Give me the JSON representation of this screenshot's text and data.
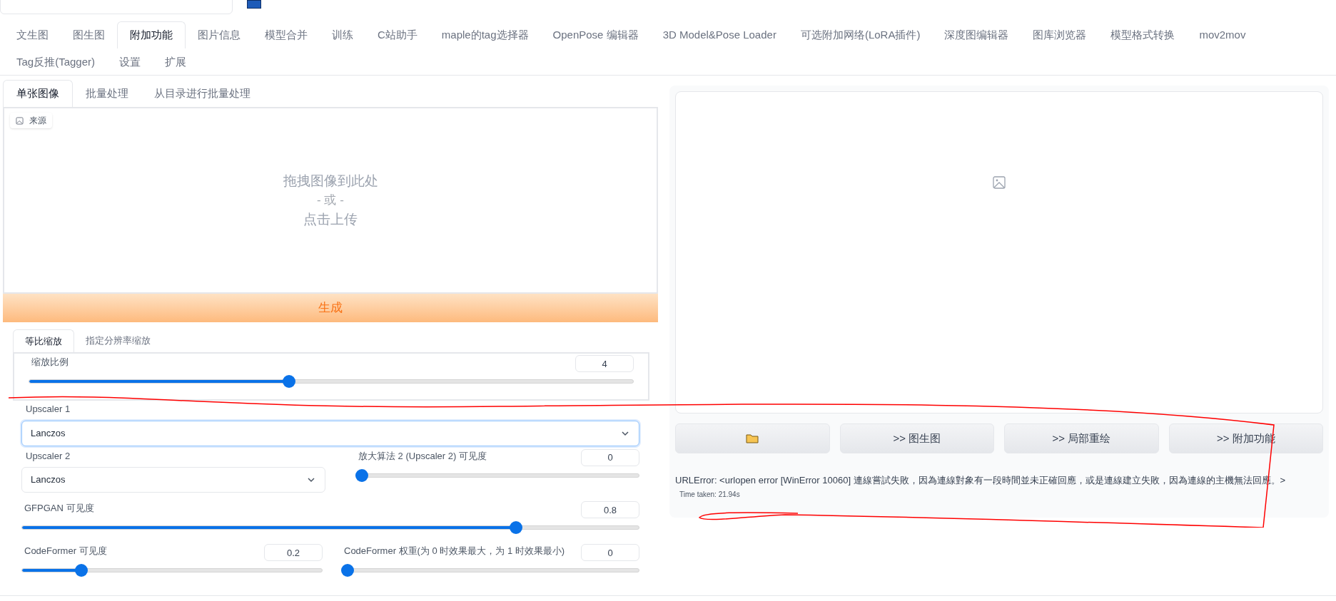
{
  "main_tabs": [
    {
      "label": "文生图",
      "selected": false
    },
    {
      "label": "图生图",
      "selected": false
    },
    {
      "label": "附加功能",
      "selected": true
    },
    {
      "label": "图片信息",
      "selected": false
    },
    {
      "label": "模型合并",
      "selected": false
    },
    {
      "label": "训练",
      "selected": false
    },
    {
      "label": "C站助手",
      "selected": false
    },
    {
      "label": "maple的tag选择器",
      "selected": false
    },
    {
      "label": "OpenPose 编辑器",
      "selected": false
    },
    {
      "label": "3D Model&Pose Loader",
      "selected": false
    },
    {
      "label": "可选附加网络(LoRA插件)",
      "selected": false
    },
    {
      "label": "深度图编辑器",
      "selected": false
    },
    {
      "label": "图库浏览器",
      "selected": false
    },
    {
      "label": "模型格式转换",
      "selected": false
    },
    {
      "label": "mov2mov",
      "selected": false
    },
    {
      "label": "Tag反推(Tagger)",
      "selected": false
    },
    {
      "label": "设置",
      "selected": false
    },
    {
      "label": "扩展",
      "selected": false
    }
  ],
  "source_tabs": [
    {
      "label": "单张图像",
      "selected": true
    },
    {
      "label": "批量处理",
      "selected": false
    },
    {
      "label": "从目录进行批量处理",
      "selected": false
    }
  ],
  "upload": {
    "badge": "来源",
    "prompt": "拖拽图像到此处",
    "or": "- 或 -",
    "click": "点击上传"
  },
  "generate_button": "生成",
  "resize_tabs": [
    {
      "label": "等比缩放",
      "selected": true
    },
    {
      "label": "指定分辨率缩放",
      "selected": false
    }
  ],
  "scale": {
    "label": "缩放比例",
    "value": "4",
    "level": 0.43
  },
  "upscaler_1": {
    "label": "Upscaler 1",
    "value": "Lanczos",
    "focused": true
  },
  "upscaler_2": {
    "label": "Upscaler 2",
    "value": "Lanczos",
    "focused": false
  },
  "upscaler_2_visibility": {
    "label": "放大算法 2 (Upscaler 2) 可见度",
    "value": "0",
    "level": 0
  },
  "gfpgan": {
    "label": "GFPGAN 可见度",
    "value": "0.8",
    "level": 0.8
  },
  "codeformer_visibility": {
    "label": "CodeFormer 可见度",
    "value": "0.2",
    "level": 0.2
  },
  "codeformer_weight": {
    "label": "CodeFormer 权重(为 0 时效果最大，为 1 时效果最小)",
    "value": "0",
    "level": 0
  },
  "output": {
    "buttons": [
      {
        "kind": "folder"
      },
      {
        "kind": "text",
        "label": ">> 图生图"
      },
      {
        "kind": "text",
        "label": ">> 局部重绘"
      },
      {
        "kind": "text",
        "label": ">> 附加功能"
      }
    ],
    "error": "URLError: <urlopen error [WinError 10060] 連線嘗試失敗，因為連線對象有一段時間並未正確回應，或是連線建立失敗，因為連線的主機無法回應。>",
    "time": "Time taken: 21.94s"
  }
}
